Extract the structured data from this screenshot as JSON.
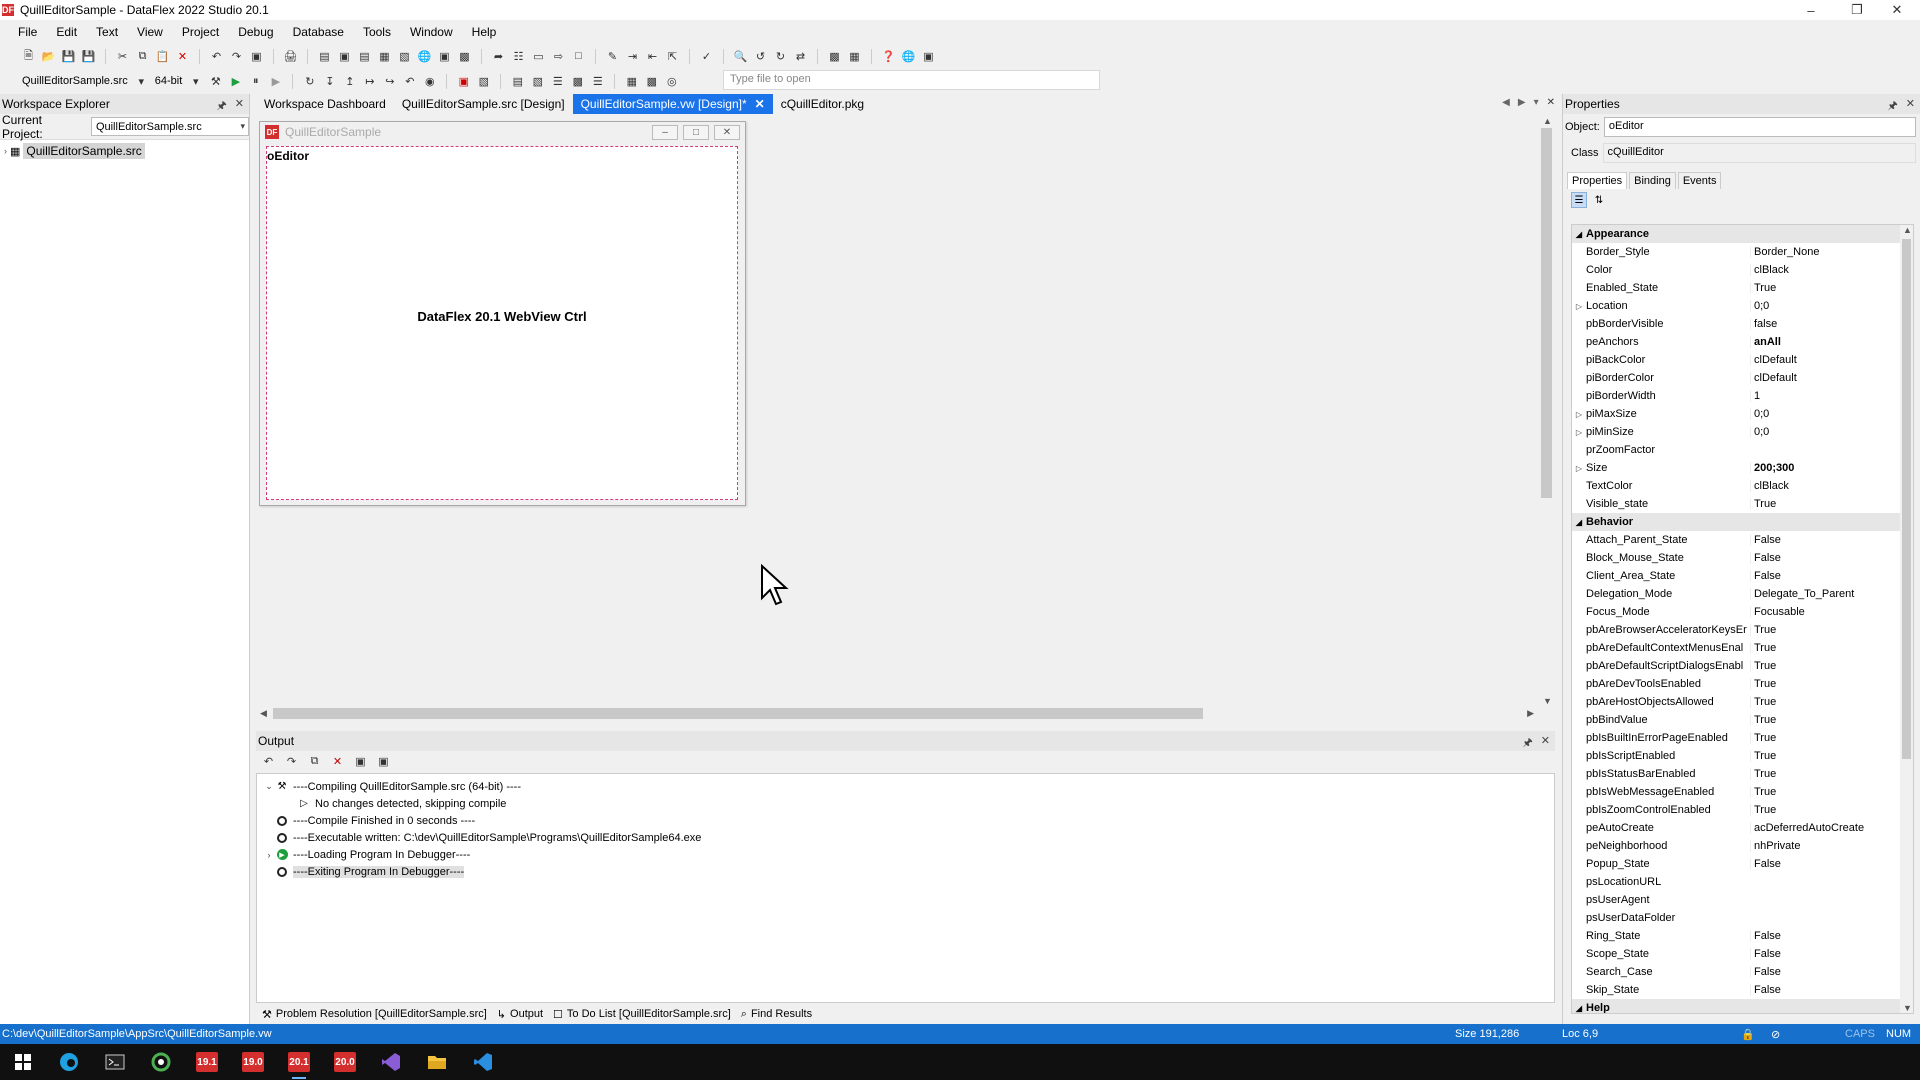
{
  "window": {
    "title": "QuillEditorSample - DataFlex 2022 Studio 20.1",
    "logo_text": "DF"
  },
  "menu": [
    "File",
    "Edit",
    "Text",
    "View",
    "Project",
    "Debug",
    "Database",
    "Tools",
    "Window",
    "Help"
  ],
  "toolbar": {
    "project_combo": "QuillEditorSample.src",
    "bitness_combo": "64-bit",
    "file_open_placeholder": "Type file to open"
  },
  "workspace_explorer": {
    "title": "Workspace Explorer",
    "current_project_label": "Current Project:",
    "current_project_value": "QuillEditorSample.src",
    "tree_root": "QuillEditorSample.src"
  },
  "tabs": [
    {
      "label": "Workspace Dashboard",
      "active": false
    },
    {
      "label": "QuillEditorSample.src [Design]",
      "active": false
    },
    {
      "label": "QuillEditorSample.vw [Design]*",
      "active": true
    },
    {
      "label": "cQuillEditor.pkg",
      "active": false
    }
  ],
  "designer": {
    "view_title": "QuillEditorSample",
    "control_name": "oEditor",
    "control_caption": "DataFlex 20.1 WebView Ctrl"
  },
  "output": {
    "title": "Output",
    "lines": [
      {
        "text": "----Compiling QuillEditorSample.src (64-bit) ----",
        "expander": "⌄",
        "icon": "compile",
        "indent": 0
      },
      {
        "text": "No changes detected, skipping compile",
        "expander": "",
        "icon": "arrow",
        "indent": 1
      },
      {
        "text": "----Compile Finished in 0 seconds ----",
        "expander": "",
        "icon": "circle",
        "indent": 0
      },
      {
        "text": "----Executable written: C:\\dev\\QuillEditorSample\\Programs\\QuillEditorSample64.exe",
        "expander": "",
        "icon": "circle",
        "indent": 0
      },
      {
        "text": "----Loading Program In Debugger----",
        "expander": "›",
        "icon": "play",
        "indent": 0
      },
      {
        "text": "----Exiting Program In Debugger----",
        "expander": "",
        "icon": "circle",
        "indent": 0,
        "selected": true
      }
    ],
    "bottom_tabs": [
      "Problem Resolution [QuillEditorSample.src]",
      "Output",
      "To Do List [QuillEditorSample.src]",
      "Find Results"
    ]
  },
  "properties": {
    "title": "Properties",
    "object_label": "Object:",
    "object_value": "oEditor",
    "class_label": "Class",
    "class_value": "cQuillEditor",
    "tabs": [
      "Properties",
      "Binding",
      "Events"
    ],
    "categories": [
      {
        "name": "Appearance",
        "rows": [
          {
            "name": "Border_Style",
            "value": "Border_None"
          },
          {
            "name": "Color",
            "value": "clBlack"
          },
          {
            "name": "Enabled_State",
            "value": "True"
          },
          {
            "name": "Location",
            "value": "0;0",
            "expandable": true
          },
          {
            "name": "pbBorderVisible",
            "value": "false"
          },
          {
            "name": "peAnchors",
            "value": "anAll",
            "bold": true
          },
          {
            "name": "piBackColor",
            "value": "clDefault"
          },
          {
            "name": "piBorderColor",
            "value": "clDefault"
          },
          {
            "name": "piBorderWidth",
            "value": "1"
          },
          {
            "name": "piMaxSize",
            "value": "0;0",
            "expandable": true
          },
          {
            "name": "piMinSize",
            "value": "0;0",
            "expandable": true
          },
          {
            "name": "prZoomFactor",
            "value": ""
          },
          {
            "name": "Size",
            "value": "200;300",
            "expandable": true,
            "bold": true
          },
          {
            "name": "TextColor",
            "value": "clBlack"
          },
          {
            "name": "Visible_state",
            "value": "True"
          }
        ]
      },
      {
        "name": "Behavior",
        "rows": [
          {
            "name": "Attach_Parent_State",
            "value": "False"
          },
          {
            "name": "Block_Mouse_State",
            "value": "False"
          },
          {
            "name": "Client_Area_State",
            "value": "False"
          },
          {
            "name": "Delegation_Mode",
            "value": "Delegate_To_Parent"
          },
          {
            "name": "Focus_Mode",
            "value": "Focusable"
          },
          {
            "name": "pbAreBrowserAcceleratorKeysEr",
            "value": "True"
          },
          {
            "name": "pbAreDefaultContextMenusEnal",
            "value": "True"
          },
          {
            "name": "pbAreDefaultScriptDialogsEnabl",
            "value": "True"
          },
          {
            "name": "pbAreDevToolsEnabled",
            "value": "True"
          },
          {
            "name": "pbAreHostObjectsAllowed",
            "value": "True"
          },
          {
            "name": "pbBindValue",
            "value": "True"
          },
          {
            "name": "pbIsBuiltInErrorPageEnabled",
            "value": "True"
          },
          {
            "name": "pbIsScriptEnabled",
            "value": "True"
          },
          {
            "name": "pbIsStatusBarEnabled",
            "value": "True"
          },
          {
            "name": "pbIsWebMessageEnabled",
            "value": "True"
          },
          {
            "name": "pbIsZoomControlEnabled",
            "value": "True"
          },
          {
            "name": "peAutoCreate",
            "value": "acDeferredAutoCreate"
          },
          {
            "name": "peNeighborhood",
            "value": "nhPrivate"
          },
          {
            "name": "Popup_State",
            "value": "False"
          },
          {
            "name": "psLocationURL",
            "value": ""
          },
          {
            "name": "psUserAgent",
            "value": ""
          },
          {
            "name": "psUserDataFolder",
            "value": ""
          },
          {
            "name": "Ring_State",
            "value": "False"
          },
          {
            "name": "Scope_State",
            "value": "False"
          },
          {
            "name": "Search_Case",
            "value": "False"
          },
          {
            "name": "Skip_State",
            "value": "False"
          }
        ]
      },
      {
        "name": "Help",
        "rows": []
      }
    ]
  },
  "statusbar": {
    "path": "C:\\dev\\QuillEditorSample\\AppSrc\\QuillEditorSample.vw",
    "size": "Size 191,286",
    "loc": "Loc 6,9",
    "caps": "CAPS",
    "num": "NUM"
  },
  "taskbar": [
    {
      "name": "windows-start",
      "label": "",
      "color": "#ffffff"
    },
    {
      "name": "edge",
      "label": "",
      "color": "#1fa0e0"
    },
    {
      "name": "terminal",
      "label": "",
      "color": "#cccccc"
    },
    {
      "name": "app-green",
      "label": "",
      "color": "#4caf50"
    },
    {
      "name": "dataflex-19-1",
      "label": "19.1",
      "color": "#d32f2f"
    },
    {
      "name": "dataflex-19-0",
      "label": "19.0",
      "color": "#d32f2f"
    },
    {
      "name": "dataflex-20-1",
      "label": "20.1",
      "color": "#d32f2f",
      "active": true
    },
    {
      "name": "dataflex-20-0",
      "label": "20.0",
      "color": "#d32f2f"
    },
    {
      "name": "visual-studio",
      "label": "",
      "color": "#8a5cd6"
    },
    {
      "name": "file-explorer",
      "label": "",
      "color": "#f5c542"
    },
    {
      "name": "vscode",
      "label": "",
      "color": "#2a8fe0"
    }
  ]
}
